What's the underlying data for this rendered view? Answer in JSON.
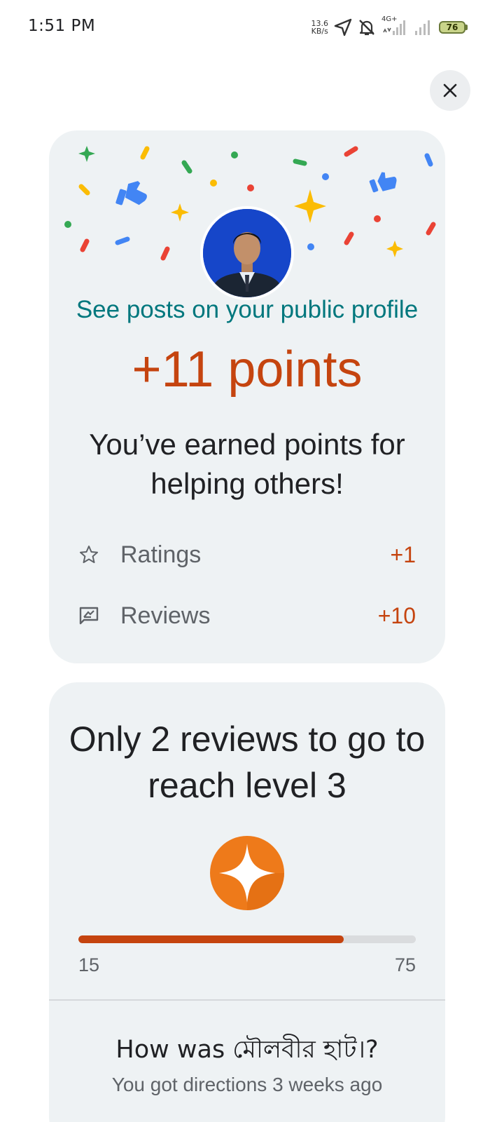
{
  "status_bar": {
    "time": "1:51 PM",
    "net_speed_value": "13.6",
    "net_speed_unit": "KB/s",
    "network_type": "4G+",
    "battery": "76",
    "icons": [
      "navigation-arrow-icon",
      "bell-off-icon",
      "signal-icon",
      "signal-icon",
      "battery-icon"
    ]
  },
  "close_button": {
    "icon": "close-icon"
  },
  "points_card": {
    "profile_link": "See posts on your public profile",
    "points_label": "+11 points",
    "earned_message": "You’ve earned points for helping others!",
    "breakdown": [
      {
        "icon": "star-outline-icon",
        "label": "Ratings",
        "value": "+1"
      },
      {
        "icon": "review-icon",
        "label": "Reviews",
        "value": "+10"
      }
    ]
  },
  "level_card": {
    "headline": "Only 2 reviews to go to reach level 3",
    "badge_icon": "local-guide-star-icon",
    "progress": {
      "min": "15",
      "max": "75",
      "fraction": 0.787
    },
    "place_question": "How was মৌলবীর হাট।?",
    "place_subtitle": "You got directions 3 weeks ago"
  },
  "colors": {
    "accent_orange": "#c5440f",
    "link_teal": "#00777d",
    "card_bg": "#eef2f4",
    "badge_orange": "#ee7a1a"
  }
}
